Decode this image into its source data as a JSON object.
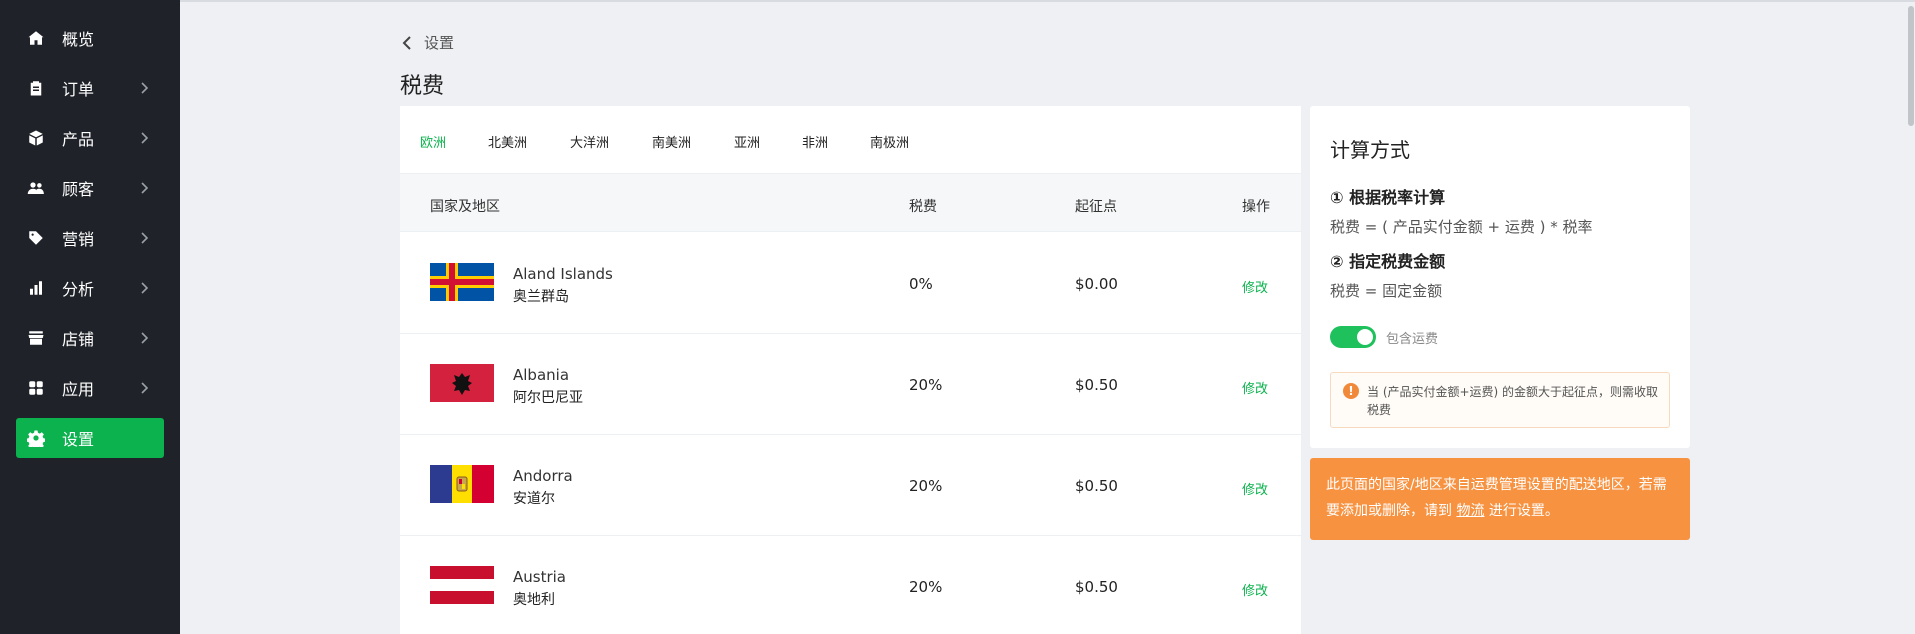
{
  "sidebar": {
    "items": [
      {
        "label": "概览",
        "icon": "home-icon",
        "chevron": false,
        "active": false
      },
      {
        "label": "订单",
        "icon": "clipboard-icon",
        "chevron": true,
        "active": false
      },
      {
        "label": "产品",
        "icon": "box-icon",
        "chevron": true,
        "active": false
      },
      {
        "label": "顾客",
        "icon": "users-icon",
        "chevron": true,
        "active": false
      },
      {
        "label": "营销",
        "icon": "tag-icon",
        "chevron": true,
        "active": false
      },
      {
        "label": "分析",
        "icon": "bar-chart-icon",
        "chevron": true,
        "active": false
      },
      {
        "label": "店铺",
        "icon": "store-icon",
        "chevron": true,
        "active": false
      },
      {
        "label": "应用",
        "icon": "apps-icon",
        "chevron": true,
        "active": false
      },
      {
        "label": "设置",
        "icon": "gear-icon",
        "chevron": false,
        "active": true
      }
    ]
  },
  "header": {
    "back_label": "设置",
    "title": "税费"
  },
  "tabs": [
    {
      "label": "欧洲",
      "active": true
    },
    {
      "label": "北美洲",
      "active": false
    },
    {
      "label": "大洋洲",
      "active": false
    },
    {
      "label": "南美洲",
      "active": false
    },
    {
      "label": "亚洲",
      "active": false
    },
    {
      "label": "非洲",
      "active": false
    },
    {
      "label": "南极洲",
      "active": false
    }
  ],
  "table": {
    "headers": {
      "country": "国家及地区",
      "tax": "税费",
      "threshold": "起征点",
      "action": "操作"
    },
    "rows": [
      {
        "name": "Aland Islands",
        "name_zh": "奥兰群岛",
        "tax": "0%",
        "threshold": "$0.00",
        "action": "修改",
        "flag": "aland-flag-icon"
      },
      {
        "name": "Albania",
        "name_zh": "阿尔巴尼亚",
        "tax": "20%",
        "threshold": "$0.50",
        "action": "修改",
        "flag": "albania-flag-icon"
      },
      {
        "name": "Andorra",
        "name_zh": "安道尔",
        "tax": "20%",
        "threshold": "$0.50",
        "action": "修改",
        "flag": "andorra-flag-icon"
      },
      {
        "name": "Austria",
        "name_zh": "奥地利",
        "tax": "20%",
        "threshold": "$0.50",
        "action": "修改",
        "flag": "austria-flag-icon"
      }
    ]
  },
  "calc": {
    "title": "计算方式",
    "method1_title": "① 根据税率计算",
    "method1_desc": "税费 = ( 产品实付金额 + 运费 ) * 税率",
    "method2_title": "② 指定税费金额",
    "method2_desc": "税费 = 固定金额",
    "toggle_label": "包含运费",
    "toggle_on": true,
    "notice": "当 (产品实付金额+运费) 的金额大于起征点，则需收取税费"
  },
  "banner": {
    "text_before": "此页面的国家/地区来自运费管理设置的配送地区，若需要添加或删除，请到 ",
    "link": "物流",
    "text_after": " 进行设置。"
  },
  "colors": {
    "sidebar_bg": "#1f2329",
    "accent": "#0bb24d",
    "banner": "#f79241",
    "page_bg": "#eef0f3"
  }
}
